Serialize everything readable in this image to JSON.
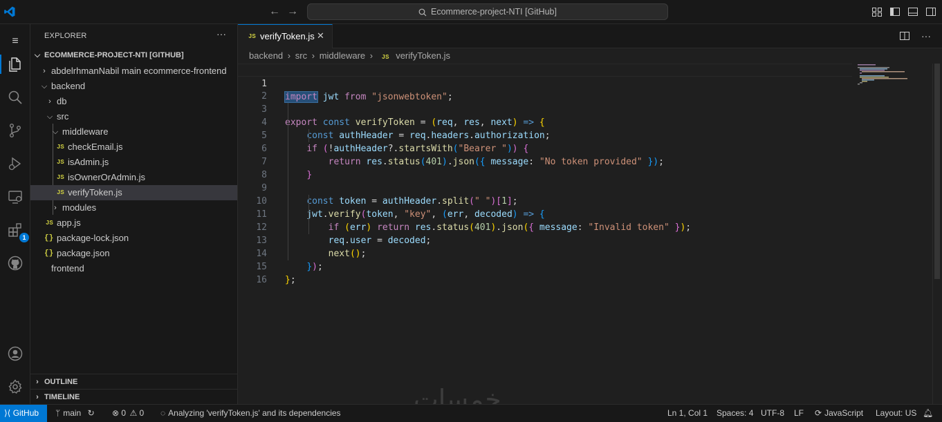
{
  "titlebar": {
    "command_center": "Ecommerce-project-NTI [GitHub]",
    "logo_icon": "vscode-logo-icon",
    "accent_color": "#0078d4"
  },
  "activity_bar": {
    "items": [
      {
        "name": "explorer-icon",
        "active": true
      },
      {
        "name": "search-icon"
      },
      {
        "name": "source-control-icon"
      },
      {
        "name": "run-debug-icon"
      },
      {
        "name": "remote-explorer-icon"
      },
      {
        "name": "extensions-icon",
        "badge": "1"
      },
      {
        "name": "github-icon"
      }
    ],
    "bottom": [
      {
        "name": "accounts-icon"
      },
      {
        "name": "settings-gear-icon"
      }
    ]
  },
  "explorer": {
    "title": "EXPLORER",
    "more": "···",
    "root": "ECOMMERCE-PROJECT-NTI [GITHUB]",
    "tree": [
      {
        "label": "abdelrhmanNabil main ecommerce-frontend",
        "type": "folder-closed"
      },
      {
        "label": "backend",
        "type": "folder-open"
      },
      {
        "label": "db",
        "type": "folder-closed"
      },
      {
        "label": "src",
        "type": "folder-open"
      },
      {
        "label": "middleware",
        "type": "folder-open"
      },
      {
        "label": "checkEmail.js",
        "type": "js"
      },
      {
        "label": "isAdmin.js",
        "type": "js"
      },
      {
        "label": "isOwnerOrAdmin.js",
        "type": "js"
      },
      {
        "label": "verifyToken.js",
        "type": "js",
        "selected": true
      },
      {
        "label": "modules",
        "type": "folder-closed"
      },
      {
        "label": "app.js",
        "type": "js"
      },
      {
        "label": "package-lock.json",
        "type": "json"
      },
      {
        "label": "package.json",
        "type": "json"
      },
      {
        "label": "frontend",
        "type": "folder-none"
      }
    ],
    "outline": "OUTLINE",
    "timeline": "TIMELINE"
  },
  "editor": {
    "tab_label": "verifyToken.js",
    "tab_icon": "JS",
    "tab_close": "✕",
    "breadcrumb": [
      "backend",
      "src",
      "middleware",
      "verifyToken.js"
    ],
    "line_numbers": [
      "1",
      "2",
      "3",
      "4",
      "5",
      "6",
      "7",
      "8",
      "9",
      "10",
      "11",
      "12",
      "13",
      "14",
      "15",
      "16"
    ],
    "lines": [
      "import jwt from \"jsonwebtoken\";",
      "",
      "export const verifyToken = (req, res, next) => {",
      "    const authHeader = req.headers.authorization;",
      "    if (!authHeader?.startsWith(\"Bearer \")) {",
      "        return res.status(401).json({ message: \"No token provided\" });",
      "    }",
      "",
      "    const token = authHeader.split(\" \")[1];",
      "    jwt.verify(token, \"key\", (err, decoded) => {",
      "        if (err) return res.status(401).json({ message: \"Invalid token\" });",
      "        req.user = decoded;",
      "        next();",
      "    });",
      "};",
      ""
    ]
  },
  "statusbar": {
    "remote": "GitHub",
    "branch": "main",
    "errors": "0",
    "warnings": "0",
    "analyzing": "Analyzing 'verifyToken.js' and its dependencies",
    "position": "Ln 1, Col 1",
    "spaces": "Spaces: 4",
    "encoding": "UTF-8",
    "eol": "LF",
    "language": "JavaScript",
    "layout": "Layout: US"
  },
  "watermark": "خمسات"
}
